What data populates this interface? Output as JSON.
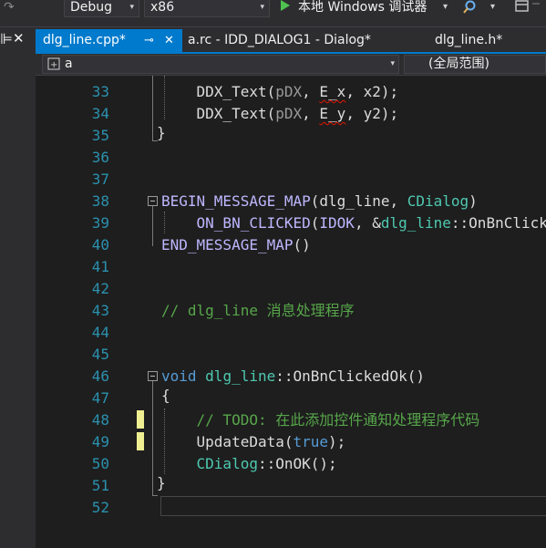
{
  "toolbar": {
    "config_value": "Debug",
    "platform_value": "x86",
    "run_label": "本地 Windows 调试器",
    "run_icon": "play-icon",
    "arrow_glyph": "▾"
  },
  "left_strip": {
    "pin_glyph": "⊫",
    "close_glyph": "✕"
  },
  "tabs": [
    {
      "label": "dlg_line.cpp*",
      "active": true,
      "pin": "⊸",
      "close": "✕"
    },
    {
      "label": "a.rc - IDD_DIALOG1 - Dialog*",
      "active": false
    },
    {
      "label": "dlg_line.h*",
      "active": false
    }
  ],
  "nav": {
    "project_value": "a",
    "scope_value": "(全局范围)"
  },
  "colors": {
    "keyword": "#569cd6",
    "macro": "#beb7ff",
    "type": "#4ec9b0",
    "comment": "#57a64a",
    "param": "#9a9a9a",
    "text": "#dcdcdc",
    "line_number": "#2b91af",
    "accent": "#007acc"
  },
  "lines": [
    {
      "n": "33",
      "tokens": [
        {
          "t": "    "
        },
        {
          "t": "DDX_Text",
          "c": "text"
        },
        {
          "t": "(",
          "c": "text"
        },
        {
          "t": "pDX",
          "c": "param"
        },
        {
          "t": ", ",
          "c": "text"
        },
        {
          "t": "E_x",
          "c": "text",
          "err": true
        },
        {
          "t": ", x2);",
          "c": "text"
        }
      ]
    },
    {
      "n": "34",
      "tokens": [
        {
          "t": "    "
        },
        {
          "t": "DDX_Text",
          "c": "text"
        },
        {
          "t": "(",
          "c": "text"
        },
        {
          "t": "pDX",
          "c": "param"
        },
        {
          "t": ", ",
          "c": "text"
        },
        {
          "t": "E_y",
          "c": "text",
          "err": true
        },
        {
          "t": ", y2);",
          "c": "text"
        }
      ]
    },
    {
      "n": "35",
      "tokens": []
    },
    {
      "n": "36",
      "tokens": []
    },
    {
      "n": "37",
      "tokens": []
    },
    {
      "n": "38",
      "tokens": [
        {
          "t": "BEGIN_MESSAGE_MAP",
          "c": "macro"
        },
        {
          "t": "(dlg_line, ",
          "c": "text"
        },
        {
          "t": "CDialog",
          "c": "type"
        },
        {
          "t": ")",
          "c": "text"
        }
      ]
    },
    {
      "n": "39",
      "tokens": [
        {
          "t": "    "
        },
        {
          "t": "ON_BN_CLICKED",
          "c": "macro"
        },
        {
          "t": "(",
          "c": "text"
        },
        {
          "t": "IDOK",
          "c": "macro"
        },
        {
          "t": ", &",
          "c": "text"
        },
        {
          "t": "dlg_line",
          "c": "type"
        },
        {
          "t": "::OnBnClickedOk)",
          "c": "text"
        }
      ]
    },
    {
      "n": "40",
      "tokens": [
        {
          "t": "END_MESSAGE_MAP",
          "c": "macro"
        },
        {
          "t": "()",
          "c": "text"
        }
      ]
    },
    {
      "n": "41",
      "tokens": []
    },
    {
      "n": "42",
      "tokens": []
    },
    {
      "n": "43",
      "tokens": [
        {
          "t": "// dlg_line 消息处理程序",
          "c": "comment"
        }
      ]
    },
    {
      "n": "44",
      "tokens": []
    },
    {
      "n": "45",
      "tokens": []
    },
    {
      "n": "46",
      "tokens": [
        {
          "t": "void",
          "c": "keyword"
        },
        {
          "t": " ",
          "c": "text"
        },
        {
          "t": "dlg_line",
          "c": "type"
        },
        {
          "t": "::OnBnClickedOk()",
          "c": "text"
        }
      ]
    },
    {
      "n": "47",
      "tokens": []
    },
    {
      "n": "48",
      "tokens": [
        {
          "t": "    "
        },
        {
          "t": "// TODO: 在此添加控件通知处理程序代码",
          "c": "comment"
        }
      ]
    },
    {
      "n": "49",
      "tokens": [
        {
          "t": "    "
        },
        {
          "t": "UpdateData",
          "c": "text"
        },
        {
          "t": "(",
          "c": "text"
        },
        {
          "t": "true",
          "c": "keyword"
        },
        {
          "t": ");",
          "c": "text"
        }
      ]
    },
    {
      "n": "50",
      "tokens": [
        {
          "t": "    "
        },
        {
          "t": "CDialog",
          "c": "type"
        },
        {
          "t": "::OnOK();",
          "c": "text"
        }
      ]
    },
    {
      "n": "51",
      "tokens": []
    },
    {
      "n": "52",
      "tokens": []
    }
  ],
  "braces": {
    "open": "{",
    "close": "}"
  }
}
